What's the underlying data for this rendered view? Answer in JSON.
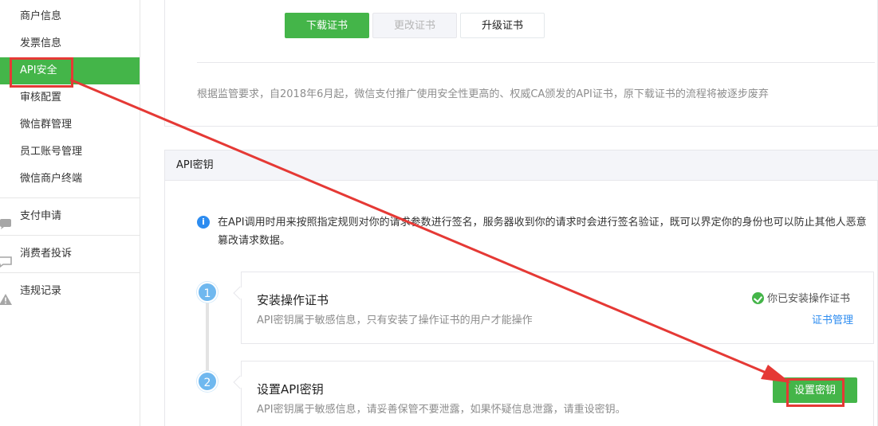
{
  "sidebar": {
    "sub_items": [
      {
        "label": "商户信息"
      },
      {
        "label": "发票信息"
      },
      {
        "label": "API安全"
      },
      {
        "label": "审核配置"
      },
      {
        "label": "微信群管理"
      },
      {
        "label": "员工账号管理"
      },
      {
        "label": "微信商户终端"
      }
    ],
    "main_items": [
      {
        "label": "支付申请",
        "icon": "chat-icon"
      },
      {
        "label": "消费者投诉",
        "icon": "message-icon"
      },
      {
        "label": "违规记录",
        "icon": "warning-icon"
      }
    ],
    "active_color": "#44b549"
  },
  "cert": {
    "download_label": "下载证书",
    "change_label": "更改证书",
    "upgrade_label": "升级证书",
    "note": "根据监管要求，自2018年6月起，微信支付推广使用安全性更高的、权威CA颁发的API证书，原下载证书的流程将被逐步废弃"
  },
  "api_key": {
    "section_title": "API密钥",
    "info": "在API调用时用来按照指定规则对你的请求参数进行签名，服务器收到你的请求时会进行签名验证，既可以界定你的身份也可以防止其他人恶意篡改请求数据。",
    "steps": [
      {
        "num": "1",
        "title": "安装操作证书",
        "desc": "API密钥属于敏感信息，只有安装了操作证书的用户才能操作",
        "status": "你已安装操作证书",
        "link": "证书管理"
      },
      {
        "num": "2",
        "title": "设置API密钥",
        "desc": "API密钥属于敏感信息，请妥善保管不要泄露，如果怀疑信息泄露，请重设密钥。",
        "button": "设置密钥"
      }
    ]
  },
  "annotation_color": "#e53935"
}
